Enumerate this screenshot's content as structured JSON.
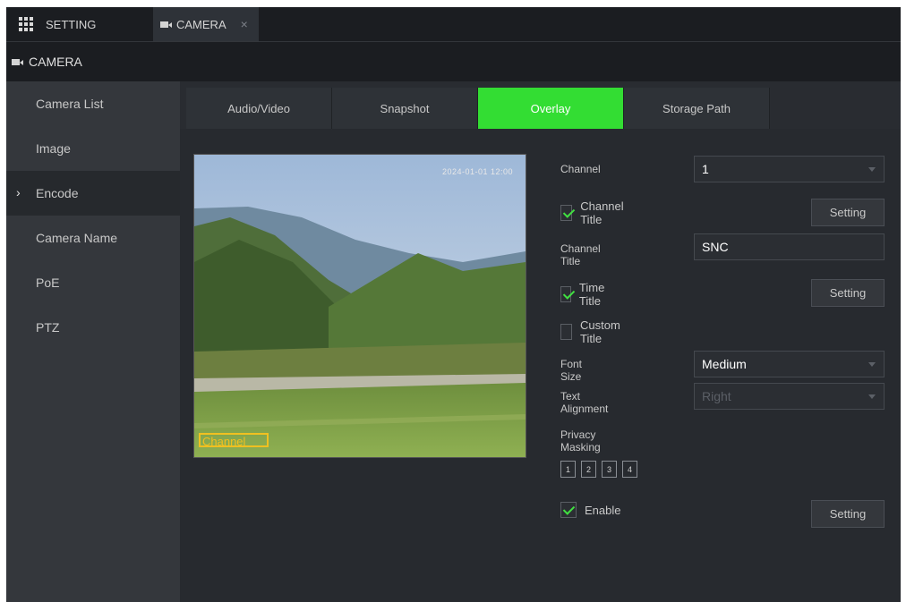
{
  "topbar": {
    "tabs": [
      {
        "label": "SETTING",
        "icon": "grid-icon"
      },
      {
        "label": "CAMERA",
        "icon": "camera-icon",
        "close": "×"
      }
    ]
  },
  "title": {
    "label": "CAMERA",
    "icon": "camera-icon"
  },
  "sidebar": {
    "items": [
      {
        "label": "Camera List",
        "active": false
      },
      {
        "label": "Image",
        "active": false
      },
      {
        "label": "Encode",
        "active": true,
        "chevron": "›"
      },
      {
        "label": "Camera Name",
        "active": false
      },
      {
        "label": "PoE",
        "active": false
      },
      {
        "label": "PTZ",
        "active": false
      }
    ]
  },
  "tabs": [
    {
      "label": "Audio/Video",
      "active": false
    },
    {
      "label": "Snapshot",
      "active": false
    },
    {
      "label": "Overlay",
      "active": true
    },
    {
      "label": "Storage Path",
      "active": false
    }
  ],
  "preview": {
    "timestamp": "2024-01-01 12:00",
    "channel_overlay": "Channel"
  },
  "form": {
    "channel": {
      "label": "Channel",
      "value": "1"
    },
    "channel_title_cb": {
      "label": "Channel Title",
      "checked": true,
      "button": "Setting"
    },
    "channel_title_field": {
      "label": "Channel Title",
      "value": "SNC"
    },
    "time_title_cb": {
      "label": "Time Title",
      "checked": true,
      "button": "Setting"
    },
    "custom_title_cb": {
      "label": "Custom Title",
      "checked": false
    },
    "font_size": {
      "label": "Font Size",
      "value": "Medium"
    },
    "text_alignment": {
      "label": "Text Alignment",
      "value": "Right"
    },
    "privacy_masking": {
      "label": "Privacy Masking",
      "areas": [
        "1",
        "2",
        "3",
        "4"
      ]
    },
    "enable_cb": {
      "label": "Enable",
      "checked": true,
      "button": "Setting"
    }
  },
  "colors": {
    "accent_green": "#33dd33",
    "check_green": "#41e041",
    "panel": "#272a2f",
    "sidebar": "#34373c",
    "overlay_yellow": "#f0c020"
  }
}
